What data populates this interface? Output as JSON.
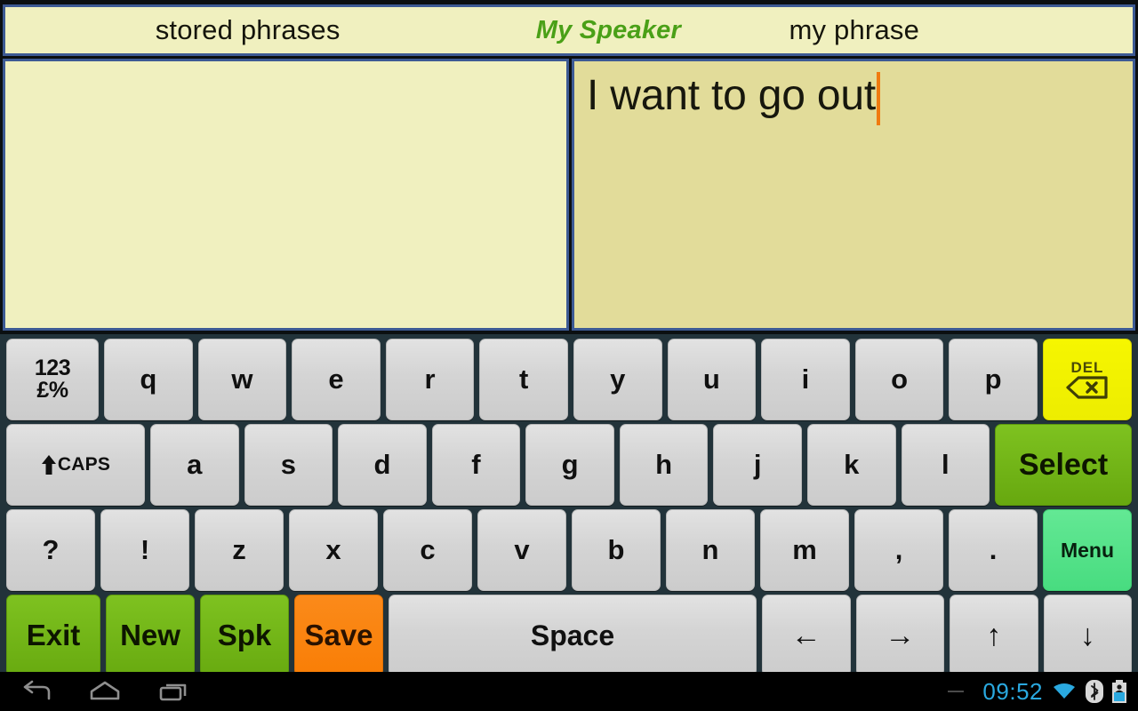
{
  "header": {
    "stored_label": "stored phrases",
    "app_title": "My Speaker",
    "myphrase_label": "my phrase"
  },
  "panels": {
    "stored_phrases": {
      "name": "stored-phrases-panel",
      "items": [],
      "background_color": "#f0f0bf",
      "border_color": "#3d5a94"
    },
    "my_phrase": {
      "name": "my-phrase-panel",
      "text": "I want to go out",
      "cursor_visible": true,
      "cursor_color": "#f07a10",
      "background_color": "#e2dc9a",
      "border_color": "#3d5a94"
    }
  },
  "keyboard": {
    "row1": [
      {
        "label_line1": "123",
        "label_line2": "£%",
        "name": "numeric-symbols-key"
      },
      {
        "label": "q",
        "name": "key-q"
      },
      {
        "label": "w",
        "name": "key-w"
      },
      {
        "label": "e",
        "name": "key-e"
      },
      {
        "label": "r",
        "name": "key-r"
      },
      {
        "label": "t",
        "name": "key-t"
      },
      {
        "label": "y",
        "name": "key-y"
      },
      {
        "label": "u",
        "name": "key-u"
      },
      {
        "label": "i",
        "name": "key-i"
      },
      {
        "label": "o",
        "name": "key-o"
      },
      {
        "label": "p",
        "name": "key-p"
      },
      {
        "label": "DEL",
        "name": "delete-key"
      }
    ],
    "row2": [
      {
        "label": "CAPS",
        "name": "caps-key"
      },
      {
        "label": "a",
        "name": "key-a"
      },
      {
        "label": "s",
        "name": "key-s"
      },
      {
        "label": "d",
        "name": "key-d"
      },
      {
        "label": "f",
        "name": "key-f"
      },
      {
        "label": "g",
        "name": "key-g"
      },
      {
        "label": "h",
        "name": "key-h"
      },
      {
        "label": "j",
        "name": "key-j"
      },
      {
        "label": "k",
        "name": "key-k"
      },
      {
        "label": "l",
        "name": "key-l"
      },
      {
        "label": "Select",
        "name": "select-key"
      }
    ],
    "row3": [
      {
        "label": "?",
        "name": "key-question"
      },
      {
        "label": "!",
        "name": "key-exclamation"
      },
      {
        "label": "z",
        "name": "key-z"
      },
      {
        "label": "x",
        "name": "key-x"
      },
      {
        "label": "c",
        "name": "key-c"
      },
      {
        "label": "v",
        "name": "key-v"
      },
      {
        "label": "b",
        "name": "key-b"
      },
      {
        "label": "n",
        "name": "key-n"
      },
      {
        "label": "m",
        "name": "key-m"
      },
      {
        "label": ",",
        "name": "key-comma"
      },
      {
        "label": ".",
        "name": "key-period"
      },
      {
        "label": "Menu",
        "name": "menu-key"
      }
    ],
    "row4": [
      {
        "label": "Exit",
        "name": "exit-key"
      },
      {
        "label": "New",
        "name": "new-key"
      },
      {
        "label": "Spk",
        "name": "speak-key"
      },
      {
        "label": "Save",
        "name": "save-key"
      },
      {
        "label": "Space",
        "name": "space-key"
      },
      {
        "label": "←",
        "name": "arrow-left-key"
      },
      {
        "label": "→",
        "name": "arrow-right-key"
      },
      {
        "label": "↑",
        "name": "arrow-up-key"
      },
      {
        "label": "↓",
        "name": "arrow-down-key"
      }
    ],
    "colors": {
      "background": "#22333a",
      "key_face": "#d6d6d6",
      "delete_key": "#f0f000",
      "select_key": "#6fb318",
      "menu_key": "#4cdc84",
      "action_green": "#71b515",
      "save_orange": "#f97e06"
    }
  },
  "system_bar": {
    "back_icon": "back-icon",
    "home_icon": "home-icon",
    "recents_icon": "recents-icon",
    "clock": "09:52",
    "wifi_icon": "wifi-icon",
    "bluetooth_icon": "bluetooth-icon",
    "battery_icon": "battery-icon",
    "clock_color": "#2aa9e0"
  }
}
